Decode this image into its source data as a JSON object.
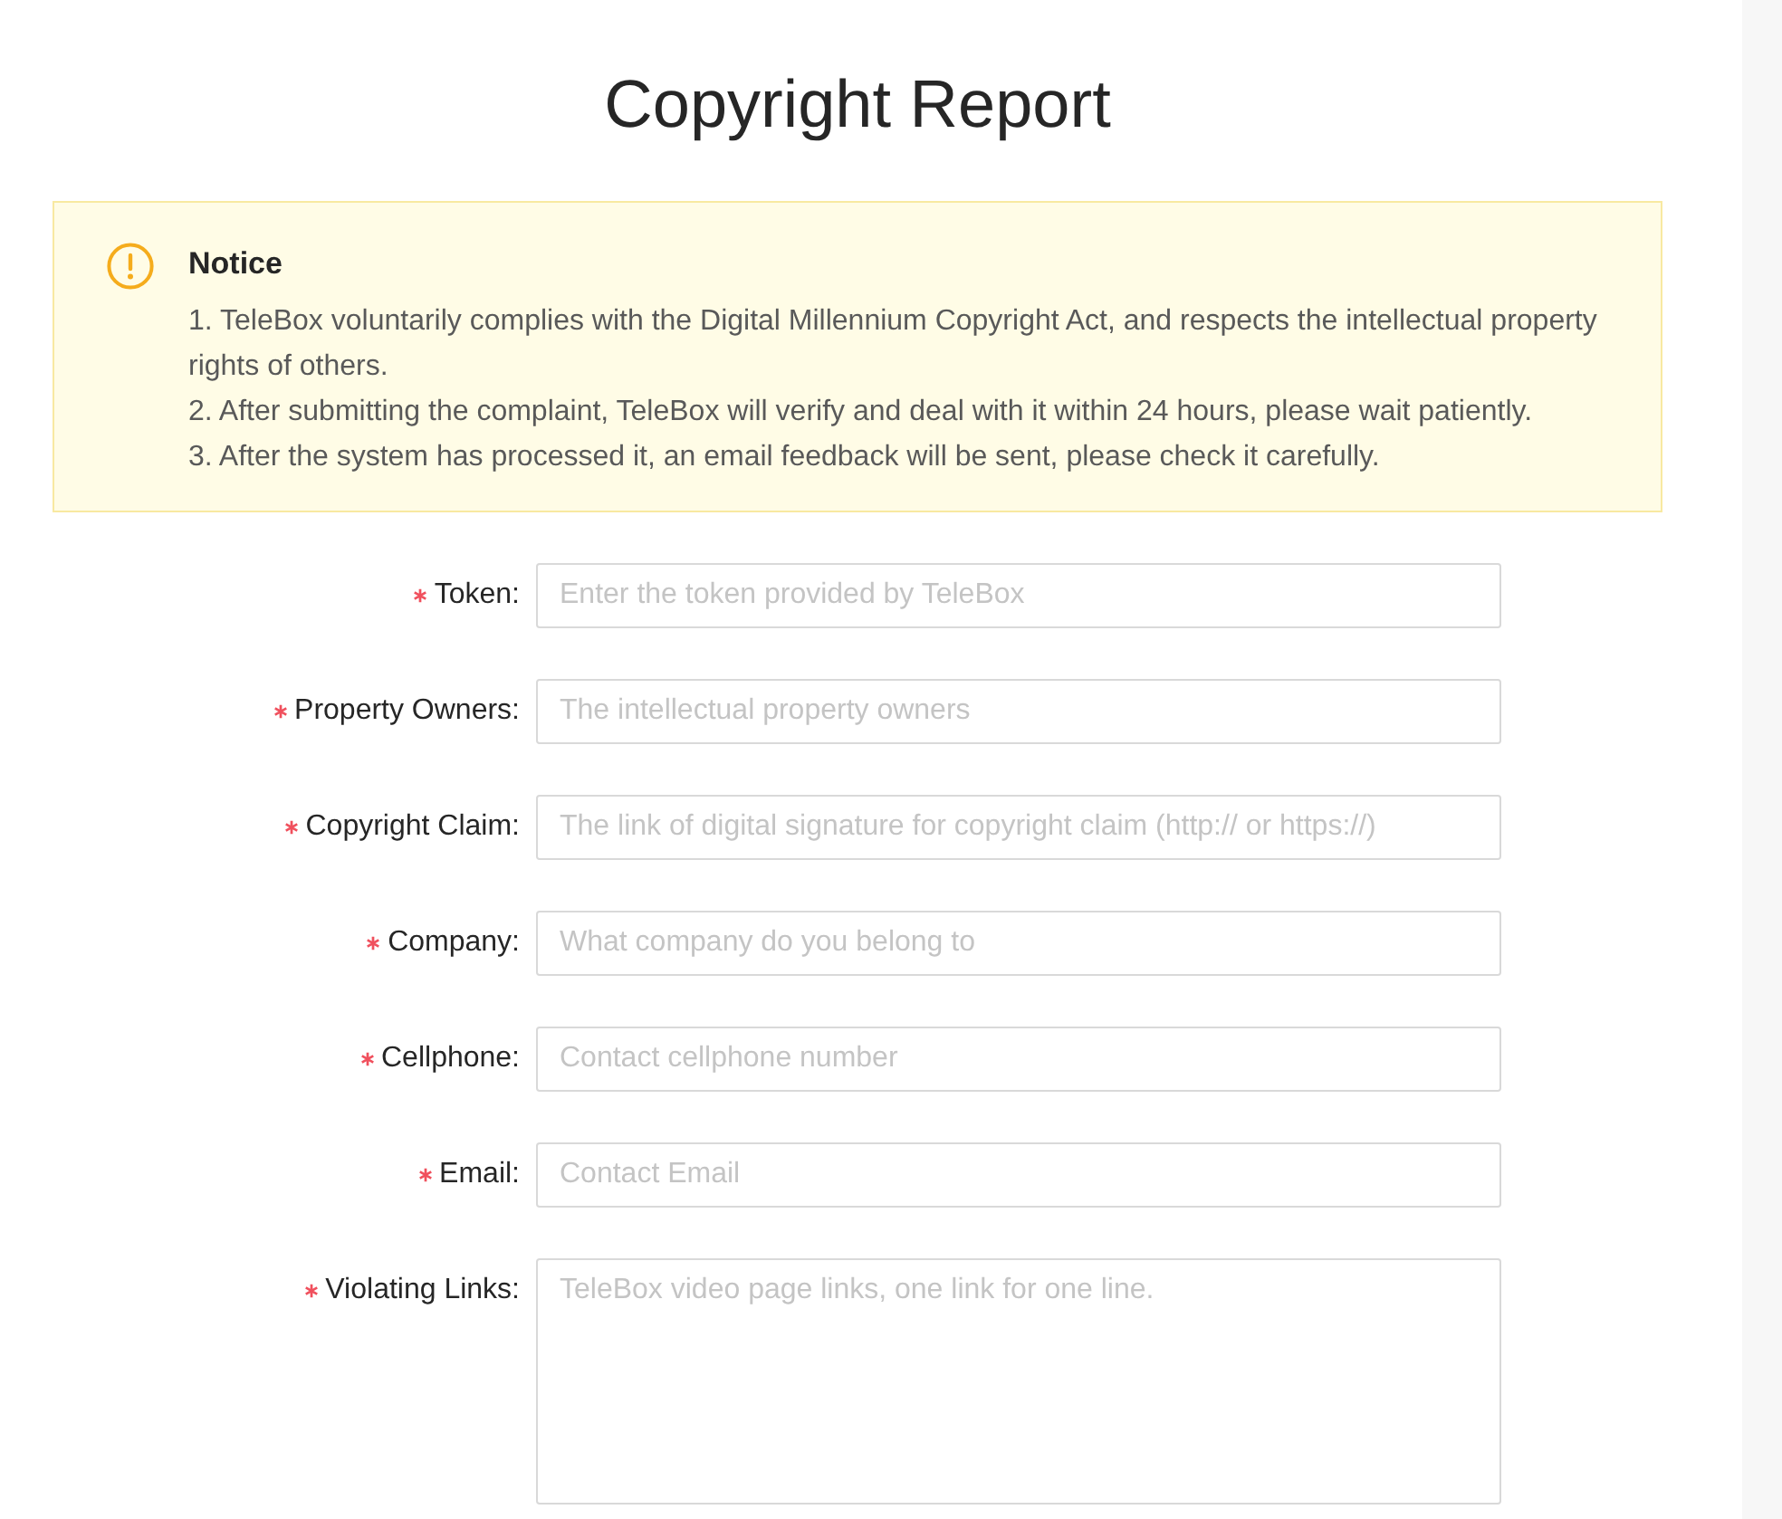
{
  "page": {
    "title": "Copyright Report"
  },
  "notice": {
    "title": "Notice",
    "lines": [
      "1. TeleBox voluntarily complies with the Digital Millennium Copyright Act, and respects the intellectual property rights of others.",
      "2. After submitting the complaint, TeleBox will verify and deal with it within 24 hours, please wait patiently.",
      "3. After the system has processed it, an email feedback will be sent, please check it carefully."
    ]
  },
  "form": {
    "fields": [
      {
        "kind": "input",
        "label": "Token:",
        "required": true,
        "placeholder": "Enter the token provided by TeleBox"
      },
      {
        "kind": "input",
        "label": "Property Owners:",
        "required": true,
        "placeholder": "The intellectual property owners"
      },
      {
        "kind": "input",
        "label": "Copyright Claim:",
        "required": true,
        "placeholder": "The link of digital signature for copyright claim (http:// or https://)"
      },
      {
        "kind": "input",
        "label": "Company:",
        "required": true,
        "placeholder": "What company do you belong to"
      },
      {
        "kind": "input",
        "label": "Cellphone:",
        "required": true,
        "placeholder": "Contact cellphone number"
      },
      {
        "kind": "input",
        "label": "Email:",
        "required": true,
        "placeholder": "Contact Email"
      },
      {
        "kind": "textarea",
        "label": "Violating Links:",
        "required": true,
        "placeholder": "TeleBox video page links, one link for one line."
      }
    ]
  }
}
